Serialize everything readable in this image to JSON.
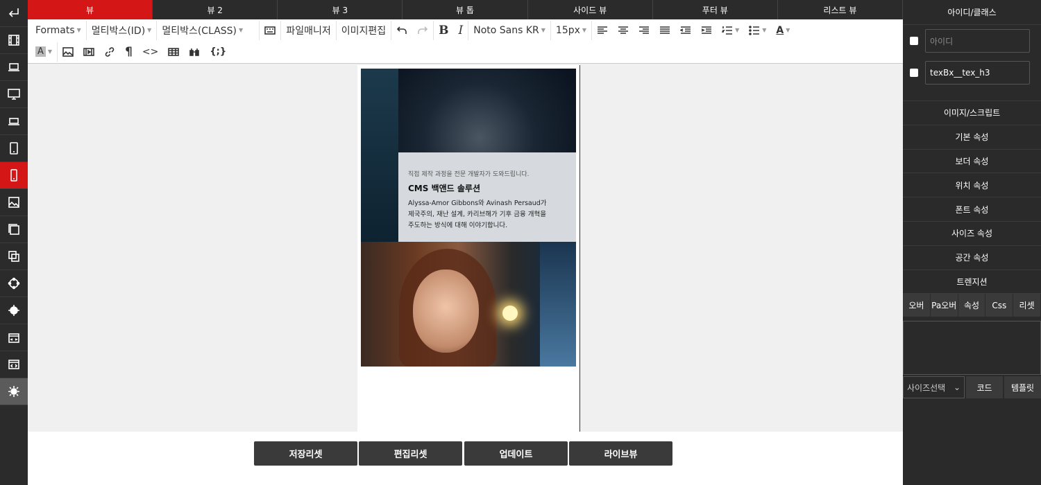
{
  "tabs": [
    "뷰",
    "뷰 2",
    "뷰 3",
    "뷰 톱",
    "사이드 뷰",
    "푸터 뷰",
    "리스트 뷰"
  ],
  "active_tab": 0,
  "toolbar": {
    "formats": "Formats",
    "multibox_id": "멀티박스(ID)",
    "multibox_class": "멀티박스(CLASS)",
    "file_manager": "파일매니저",
    "image_edit": "이미지편집",
    "bold": "B",
    "italic": "I",
    "font_family": "Noto Sans KR",
    "font_size": "15px",
    "text_color": "A",
    "bg_color": "A",
    "paragraph": "¶",
    "code": "<>",
    "source": "{;}"
  },
  "content": {
    "card_sub": "직접 제작 과정을 전문 개발자가 도와드립니다.",
    "card_title": "CMS 백앤드 솔루션",
    "card_body_1": "Alyssa-Amor Gibbons와 Avinash Persaud가",
    "card_body_2": "제국주의, 재난 설계, 카리브해가 기후 금융 개혁을",
    "card_body_3": "주도하는 방식에 대해 이야기합니다."
  },
  "bottom_buttons": [
    "저장리셋",
    "편집리셋",
    "업데이트",
    "라이브뷰"
  ],
  "right_panel": {
    "title": "아이디/클래스",
    "id_placeholder": "아이디",
    "class_value": "texBx__tex_h3",
    "sections": [
      "이미지/스크립트",
      "기본 속성",
      "보더 속성",
      "위치 속성",
      "폰트 속성",
      "사이즈 속성",
      "공간 속성",
      "트렌지션"
    ],
    "sub_tabs": [
      "오버",
      "Pa오버",
      "속성",
      "Css",
      "리셋"
    ],
    "size_select": "사이즈선택",
    "code_button": "코드",
    "template_button": "템플릿"
  },
  "colors": {
    "accent": "#d51616",
    "dark": "#2b2b2b"
  },
  "sidebar_icons": [
    "enter-icon",
    "film-icon",
    "laptop-icon",
    "desktop-icon",
    "laptop-small-icon",
    "tablet-icon",
    "mobile-icon",
    "image-icon",
    "page-icon",
    "copy-icon",
    "nodes-icon",
    "gear-badge-icon",
    "film-code-icon",
    "code-window-icon",
    "settings-icon"
  ]
}
